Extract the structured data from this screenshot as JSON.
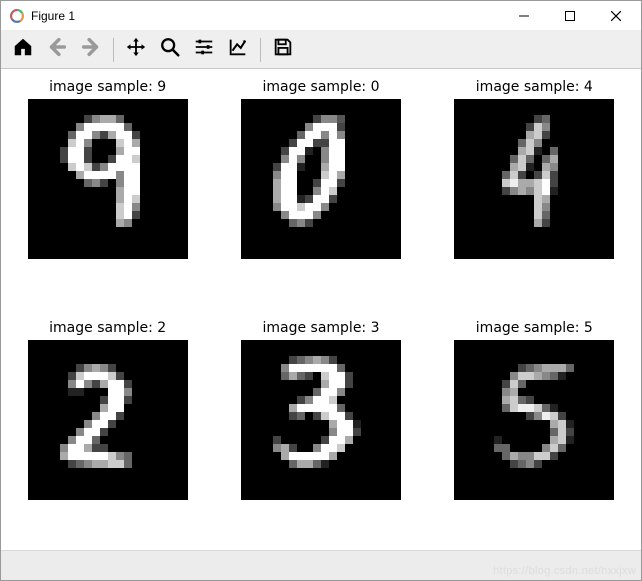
{
  "window": {
    "title": "Figure 1"
  },
  "toolbar": {
    "home": "home-icon",
    "back": "arrow-left-icon",
    "forward": "arrow-right-icon",
    "pan": "move-icon",
    "zoom": "zoom-icon",
    "subplots": "sliders-icon",
    "axes": "axes-icon",
    "save": "save-icon"
  },
  "samples": [
    {
      "label": "image sample: 9",
      "digit": 9
    },
    {
      "label": "image sample: 0",
      "digit": 0
    },
    {
      "label": "image sample: 4",
      "digit": 4
    },
    {
      "label": "image sample: 2",
      "digit": 2
    },
    {
      "label": "image sample: 3",
      "digit": 3
    },
    {
      "label": "image sample: 5",
      "digit": 5
    }
  ],
  "watermark": "https://blog.csdn.net/hxxjxw"
}
